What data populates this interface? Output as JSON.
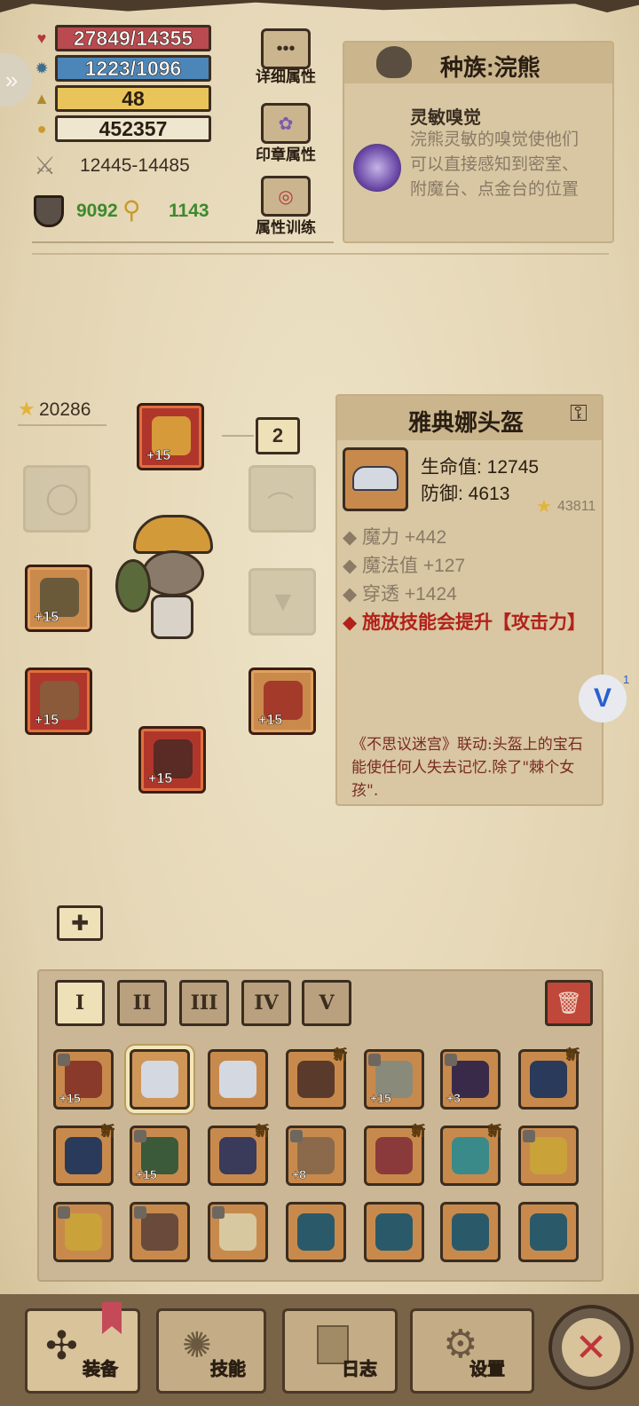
{
  "stats": {
    "hp": "27849/14355",
    "mp": "1223/1096",
    "level": "48",
    "gold": "452357",
    "attack": "12445-14485",
    "defense": "9092",
    "keys": "1143"
  },
  "menu": {
    "detail": "详细属性",
    "seal": "印章属性",
    "training": "属性训练"
  },
  "race": {
    "title": "种族:浣熊",
    "trait_name": "灵敏嗅觉",
    "trait_desc": "浣熊灵敏的嗅觉使他们可以直接感知到密室、附魔台、点金台的位置"
  },
  "character": {
    "score": "20286",
    "badge": "2",
    "slots": {
      "helmet": "+15",
      "weapon": "+15",
      "offhand": "+15",
      "pants": "+15",
      "boots": "+15"
    }
  },
  "item": {
    "name": "雅典娜头盔",
    "hp_label": "生命值: 12745",
    "def_label": "防御: 4613",
    "score": "43811",
    "attrs": [
      "魔力 +442",
      "魔法值 +127",
      "穿透 +1424"
    ],
    "special": "施放技能会提升【攻击力】",
    "flavor": "《不思议迷宫》联动:头盔上的宝石能使任何人失去记忆.除了\"棘个女孩\"."
  },
  "floating_badge": "1",
  "tabs": [
    "I",
    "II",
    "III",
    "IV",
    "V"
  ],
  "inventory": [
    {
      "lvl": "+15",
      "new": "",
      "lock": true
    },
    {
      "lvl": "",
      "new": "",
      "lock": false
    },
    {
      "lvl": "",
      "new": "",
      "lock": false
    },
    {
      "lvl": "",
      "new": "新",
      "lock": false
    },
    {
      "lvl": "+15",
      "new": "",
      "lock": true
    },
    {
      "lvl": "+3",
      "new": "",
      "lock": true
    },
    {
      "lvl": "",
      "new": "新",
      "lock": false
    },
    {
      "lvl": "",
      "new": "新",
      "lock": false
    },
    {
      "lvl": "+15",
      "new": "",
      "lock": true
    },
    {
      "lvl": "",
      "new": "新",
      "lock": false
    },
    {
      "lvl": "+8",
      "new": "",
      "lock": true
    },
    {
      "lvl": "",
      "new": "新",
      "lock": false
    },
    {
      "lvl": "",
      "new": "新",
      "lock": false
    },
    {
      "lvl": "",
      "new": "",
      "lock": true
    },
    {
      "lvl": "",
      "new": "",
      "lock": true
    },
    {
      "lvl": "",
      "new": "",
      "lock": true
    },
    {
      "lvl": "",
      "new": "",
      "lock": true
    },
    {
      "lvl": "",
      "new": "",
      "lock": false
    },
    {
      "lvl": "",
      "new": "",
      "lock": false
    },
    {
      "lvl": "",
      "new": "",
      "lock": false
    },
    {
      "lvl": "",
      "new": "",
      "lock": false
    }
  ],
  "nav": {
    "equip": "装备",
    "skills": "技能",
    "log": "日志",
    "settings": "设置"
  },
  "colors": {
    "hp_bar": "#b94a4f",
    "mp_bar": "#4c86b8",
    "level_bar": "#e9c45a",
    "special_text": "#b2211b",
    "defense_green": "#3c8a2c"
  }
}
